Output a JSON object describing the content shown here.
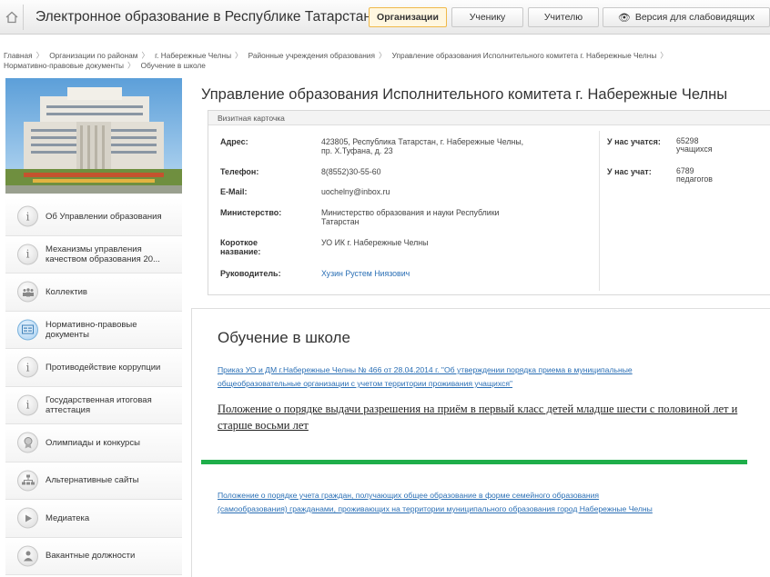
{
  "header": {
    "site_title": "Электронное образование в Республике Татарстан",
    "nav": [
      {
        "label": "Организации",
        "active": true
      },
      {
        "label": "Ученику",
        "active": false
      },
      {
        "label": "Учителю",
        "active": false
      },
      {
        "label": "Версия для слабовидящих",
        "active": false
      }
    ]
  },
  "breadcrumb": [
    "Главная",
    "Организации по районам",
    "г. Набережные Челны",
    "Районные учреждения образования",
    "Управление образования Исполнительного комитета г. Набережные Челны",
    "Нормативно-правовые документы",
    "Обучение в школе"
  ],
  "sidebar": {
    "items": [
      {
        "label": "Об Управлении образования",
        "icon": "info-icon"
      },
      {
        "label": "Механизмы управления качеством образования 20...",
        "icon": "info-icon"
      },
      {
        "label": "Коллектив",
        "icon": "people-icon"
      },
      {
        "label": "Нормативно-правовые документы",
        "icon": "document-icon",
        "active": true
      },
      {
        "label": "Противодействие коррупции",
        "icon": "info-icon"
      },
      {
        "label": "Государственная итоговая аттестация",
        "icon": "info-icon"
      },
      {
        "label": "Олимпиады и конкурсы",
        "icon": "medal-icon"
      },
      {
        "label": "Альтернативные сайты",
        "icon": "sitemap-icon"
      },
      {
        "label": "Медиатека",
        "icon": "play-icon"
      },
      {
        "label": "Вакантные должности",
        "icon": "person-icon"
      }
    ]
  },
  "organization": {
    "title": "Управление образования Исполнительного комитета г. Набережные Челны",
    "card_header": "Визитная карточка",
    "fields": {
      "address_label": "Адрес:",
      "address_line1": "423805, Республика Татарстан, г. Набережные Челны,",
      "address_line2": "пр. Х.Туфана, д. 23",
      "phone_label": "Телефон:",
      "phone": "8(8552)30-55-60",
      "email_label": "E-Mail:",
      "email": "uochelny@inbox.ru",
      "ministry_label": "Министерство:",
      "ministry_line1": "Министерство образования и науки Республики",
      "ministry_line2": "Татарстан",
      "short_name_label_line1": "Короткое",
      "short_name_label_line2": "название:",
      "short_name": "УО ИК г. Набережные Челны",
      "head_label": "Руководитель:",
      "head": "Хузин Рустем Ниязович"
    },
    "stats": {
      "students_label": "У нас учатся:",
      "students_count": "65298",
      "students_unit": "учащихся",
      "teachers_label": "У нас учат:",
      "teachers_count": "6789",
      "teachers_unit": "педагогов"
    }
  },
  "section": {
    "title": "Обучение в школе",
    "docs": [
      {
        "line1": "Приказ УО и ДМ г.Набережные Челны № 466 от 28.04.2014 г. \"Об утверждении порядка приема в муниципальные",
        "line2": "общеобразовательные организации с учетом территории проживания учащихся\""
      },
      {
        "text": "Положение о порядке выдачи разрешения на приём в первый класс детей  младше шести с половиной лет и старше восьми лет"
      },
      {
        "line1": "Положение о порядке учета граждан, получающих  общее образование в форме семейного образования",
        "line2": "(самообразования) гражданами, проживающих на территории муниципального образования  город  Набережные Челны"
      }
    ]
  },
  "colors": {
    "accent_orange": "#f0b94a",
    "link_blue": "#2a6fb5",
    "green_bar": "#1fae4a"
  }
}
